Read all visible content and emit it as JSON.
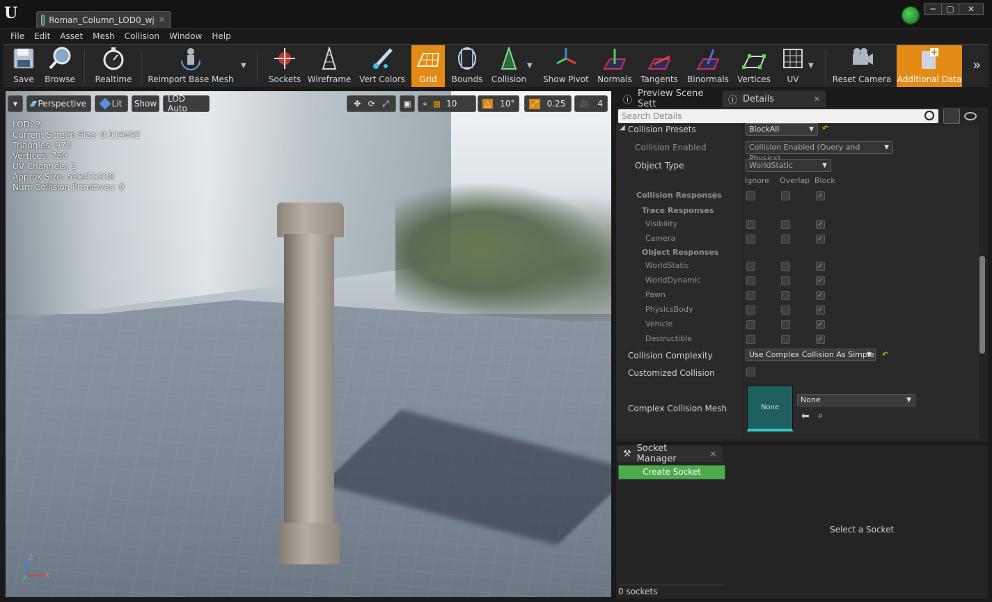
{
  "window": {
    "tab_title": "Roman_Column_LOD0_wj",
    "controls": [
      "─",
      "▢",
      "✕"
    ]
  },
  "menu": [
    "File",
    "Edit",
    "Asset",
    "Mesh",
    "Collision",
    "Window",
    "Help"
  ],
  "toolbar": {
    "save": "Save",
    "browse": "Browse",
    "realtime": "Realtime",
    "reimport": "Reimport Base Mesh",
    "sockets": "Sockets",
    "wireframe": "Wireframe",
    "vert_colors": "Vert Colors",
    "grid": "Grid",
    "bounds": "Bounds",
    "collision": "Collision",
    "show_pivot": "Show Pivot",
    "normals": "Normals",
    "tangents": "Tangents",
    "binormals": "Binormals",
    "vertices": "Vertices",
    "uv": "UV",
    "reset_camera": "Reset Camera",
    "additional_data": "Additional Data",
    "active_color": "#e38b14"
  },
  "viewport": {
    "perspective": "Perspective",
    "lit": "Lit",
    "show": "Show",
    "lod": "LOD Auto",
    "grid_snap": "10",
    "rotation_snap": "10°",
    "scale_snap": "0.25",
    "camera_speed": "4",
    "stats": [
      "LOD:  2",
      "Current Screen Size:  0.519492",
      "Triangles:  970",
      "Vertices:  750",
      "UV Channels:  1",
      "Approx Size: 52x47x238",
      "Num Collision Primitives:  0"
    ],
    "axis_z": "Z",
    "axis_x": "X"
  },
  "details": {
    "tab_preview": "Preview Scene Sett",
    "tab_details": "Details",
    "search_placeholder": "Search Details",
    "collision_presets_label": "Collision Presets",
    "collision_presets_value": "BlockAll",
    "collision_enabled_label": "Collision Enabled",
    "collision_enabled_value": "Collision Enabled (Query and Physics)",
    "object_type_label": "Object Type",
    "object_type_value": "WorldStatic",
    "col_ignore": "Ignore",
    "col_overlap": "Overlap",
    "col_block": "Block",
    "collision_responses_label": "Collision Responses",
    "trace_responses_label": "Trace Responses",
    "trace_rows": [
      "Visibility",
      "Camera"
    ],
    "object_responses_label": "Object Responses",
    "object_rows": [
      "WorldStatic",
      "WorldDynamic",
      "Pawn",
      "PhysicsBody",
      "Vehicle",
      "Destructible"
    ],
    "collision_complexity_label": "Collision Complexity",
    "collision_complexity_value": "Use Complex Collision As Simple",
    "customized_collision_label": "Customized Collision",
    "complex_collision_mesh_label": "Complex Collision Mesh",
    "complex_collision_mesh_thumb": "None",
    "complex_collision_mesh_value": "None"
  },
  "socket_manager": {
    "tab": "Socket Manager",
    "create_button": "Create Socket",
    "hint": "Select a Socket",
    "count": "0 sockets"
  }
}
